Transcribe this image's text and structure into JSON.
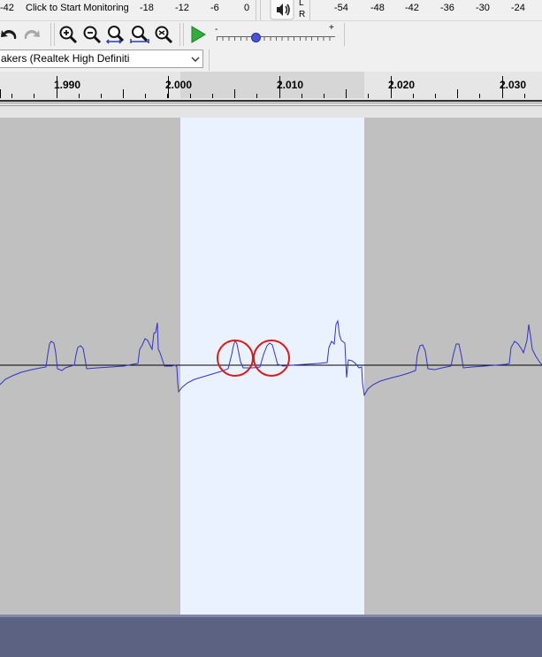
{
  "meter": {
    "left_ticks": [
      "-42",
      "-18",
      "-12",
      "-6",
      "0"
    ],
    "monitor_label": "Click to Start Monitoring",
    "speaker_icon": "speaker-icon",
    "channel_L": "L",
    "channel_R": "R",
    "right_ticks": [
      "-54",
      "-48",
      "-42",
      "-36",
      "-30",
      "-24"
    ]
  },
  "toolbar": {
    "icons": [
      "undo-icon",
      "redo-icon",
      "zoom-in-icon",
      "zoom-out-icon",
      "fit-selection-icon",
      "fit-project-icon",
      "zoom-toggle-icon",
      "play-at-speed-icon"
    ],
    "speed_min": "-",
    "speed_max": "+"
  },
  "device": {
    "output_device": "akers (Realtek High Definiti"
  },
  "ruler": {
    "labels": [
      "1.990",
      "2.000",
      "2.010",
      "2.020",
      "2.030"
    ]
  },
  "colors": {
    "waveform": "#3232c8",
    "selection": "#eaf2ff",
    "track_bg": "#c0c0c0",
    "annotation_circle": "#d81b1b",
    "bottom_panel": "#5c6281"
  }
}
